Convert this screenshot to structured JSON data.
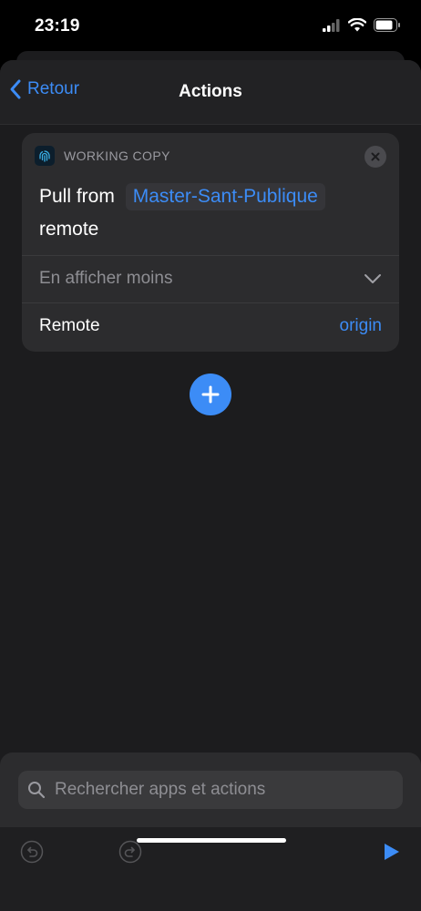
{
  "status": {
    "time": "23:19"
  },
  "nav": {
    "back_label": "Retour",
    "title": "Actions"
  },
  "action_card": {
    "app_name": "WORKING COPY",
    "text_prefix": "Pull from",
    "repo_param": "Master-Sant-Publique",
    "text_suffix": "remote",
    "collapse_label": "En afficher moins",
    "remote_label": "Remote",
    "remote_value": "origin"
  },
  "search": {
    "placeholder": "Rechercher apps et actions"
  },
  "colors": {
    "accent": "#3c8cf6",
    "background": "#1c1c1e",
    "card": "#2c2c2e"
  },
  "icons": [
    "fingerprint-icon",
    "close-icon",
    "chevron-left-icon",
    "chevron-down-icon",
    "plus-icon",
    "search-icon",
    "undo-icon",
    "redo-icon",
    "play-icon"
  ]
}
